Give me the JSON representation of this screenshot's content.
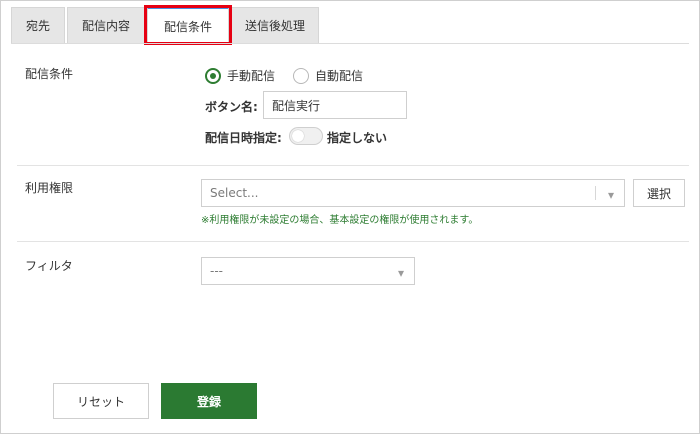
{
  "tabs": [
    {
      "label": "宛先"
    },
    {
      "label": "配信内容"
    },
    {
      "label": "配信条件"
    },
    {
      "label": "送信後処理"
    }
  ],
  "delivery": {
    "label": "配信条件",
    "radio_manual": "手動配信",
    "radio_auto": "自動配信",
    "button_name_label": "ボタン名:",
    "button_name_value": "配信実行",
    "schedule_label": "配信日時指定:",
    "schedule_toggle_text": "指定しない"
  },
  "permission": {
    "label": "利用権限",
    "select_placeholder": "Select...",
    "select_button": "選択",
    "hint": "※利用権限が未設定の場合、基本設定の権限が使用されます。"
  },
  "filter": {
    "label": "フィルタ",
    "select_value": "---"
  },
  "footer": {
    "reset": "リセット",
    "submit": "登録"
  },
  "colors": {
    "accent_green": "#2b7a32",
    "highlight_red": "#e60012"
  }
}
